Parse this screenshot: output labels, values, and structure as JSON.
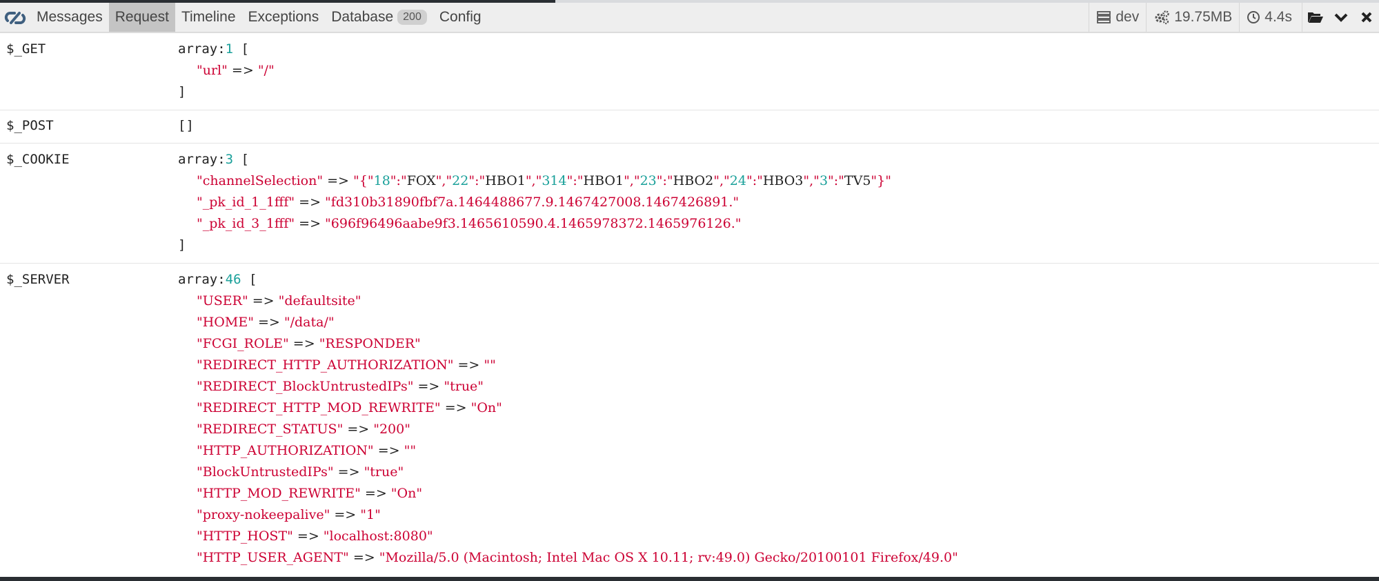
{
  "toolbar": {
    "tabs": [
      {
        "label": "Messages"
      },
      {
        "label": "Request"
      },
      {
        "label": "Timeline"
      },
      {
        "label": "Exceptions"
      },
      {
        "label": "Database",
        "badge": "200"
      },
      {
        "label": "Config"
      }
    ],
    "env": "dev",
    "memory": "19.75MB",
    "duration": "4.4s"
  },
  "request": {
    "get": {
      "key": "$_GET",
      "header": "array:",
      "count": "1",
      "items": [
        {
          "k": "\"url\"",
          "v": "\"/\""
        }
      ]
    },
    "post": {
      "key": "$_POST",
      "value": "[]"
    },
    "cookie": {
      "key": "$_COOKIE",
      "header": "array:",
      "count": "3",
      "channel": {
        "k": "\"channelSelection\"",
        "parts": [
          {
            "t": "s",
            "v": "\"{\""
          },
          {
            "t": "n",
            "v": "18"
          },
          {
            "t": "s",
            "v": "\":\""
          },
          {
            "t": "p",
            "v": "FOX"
          },
          {
            "t": "s",
            "v": "\",\""
          },
          {
            "t": "n",
            "v": "22"
          },
          {
            "t": "s",
            "v": "\":\""
          },
          {
            "t": "p",
            "v": "HBO1"
          },
          {
            "t": "s",
            "v": "\",\""
          },
          {
            "t": "n",
            "v": "314"
          },
          {
            "t": "s",
            "v": "\":\""
          },
          {
            "t": "p",
            "v": "HBO1"
          },
          {
            "t": "s",
            "v": "\",\""
          },
          {
            "t": "n",
            "v": "23"
          },
          {
            "t": "s",
            "v": "\":\""
          },
          {
            "t": "p",
            "v": "HBO2"
          },
          {
            "t": "s",
            "v": "\",\""
          },
          {
            "t": "n",
            "v": "24"
          },
          {
            "t": "s",
            "v": "\":\""
          },
          {
            "t": "p",
            "v": "HBO3"
          },
          {
            "t": "s",
            "v": "\",\""
          },
          {
            "t": "n",
            "v": "3"
          },
          {
            "t": "s",
            "v": "\":\""
          },
          {
            "t": "p",
            "v": "TV5"
          },
          {
            "t": "s",
            "v": "\"}\""
          }
        ]
      },
      "items": [
        {
          "k": "\"_pk_id_1_1fff\"",
          "v": "\"fd310b31890fbf7a.1464488677.9.1467427008.1467426891.\""
        },
        {
          "k": "\"_pk_id_3_1fff\"",
          "v": "\"696f96496aabe9f3.1465610590.4.1465978372.1465976126.\""
        }
      ]
    },
    "server": {
      "key": "$_SERVER",
      "header": "array:",
      "count": "46",
      "items": [
        {
          "k": "\"USER\"",
          "v": "\"defaultsite\""
        },
        {
          "k": "\"HOME\"",
          "v": "\"/data/\""
        },
        {
          "k": "\"FCGI_ROLE\"",
          "v": "\"RESPONDER\""
        },
        {
          "k": "\"REDIRECT_HTTP_AUTHORIZATION\"",
          "v": "\"\""
        },
        {
          "k": "\"REDIRECT_BlockUntrustedIPs\"",
          "v": "\"true\""
        },
        {
          "k": "\"REDIRECT_HTTP_MOD_REWRITE\"",
          "v": "\"On\""
        },
        {
          "k": "\"REDIRECT_STATUS\"",
          "v": "\"200\""
        },
        {
          "k": "\"HTTP_AUTHORIZATION\"",
          "v": "\"\""
        },
        {
          "k": "\"BlockUntrustedIPs\"",
          "v": "\"true\""
        },
        {
          "k": "\"HTTP_MOD_REWRITE\"",
          "v": "\"On\""
        },
        {
          "k": "\"proxy-nokeepalive\"",
          "v": "\"1\""
        },
        {
          "k": "\"HTTP_HOST\"",
          "v": "\"localhost:8080\""
        },
        {
          "k": "\"HTTP_USER_AGENT\"",
          "v": "\"Mozilla/5.0 (Macintosh; Intel Mac OS X 10.11; rv:49.0) Gecko/20100101 Firefox/49.0\""
        }
      ]
    }
  },
  "colors": {
    "string": "#cc0033",
    "number": "#1aa09a",
    "active_tab": "#c4c4c4",
    "toolbar_bg": "#eeeeee"
  }
}
